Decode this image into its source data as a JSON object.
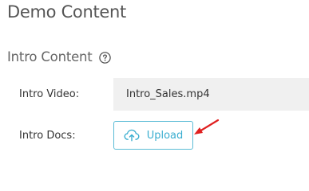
{
  "page": {
    "title": "Demo Content"
  },
  "section": {
    "heading": "Intro Content",
    "help_icon": "question-circle-icon"
  },
  "fields": {
    "video": {
      "label": "Intro Video:",
      "value": "Intro_Sales.mp4"
    },
    "docs": {
      "label": "Intro Docs:",
      "button_label": "Upload",
      "button_icon": "cloud-upload-icon"
    }
  },
  "annotation": {
    "icon": "red-arrow-icon",
    "color": "#e02020"
  },
  "colors": {
    "accent": "#3aaed0",
    "accent_border": "#5bbcd6",
    "readonly_bg": "#f0f0f0"
  }
}
